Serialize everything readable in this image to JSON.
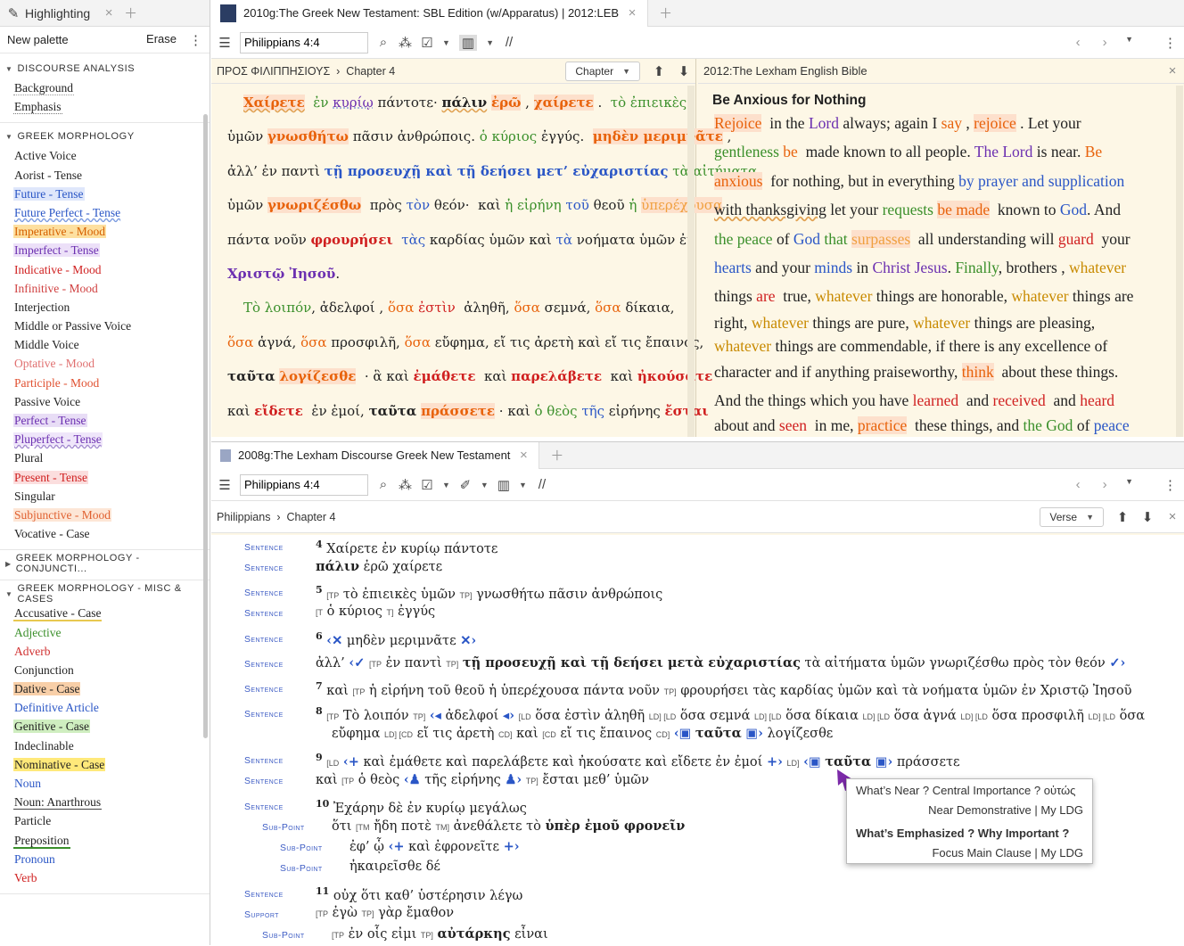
{
  "palette": {
    "tab": "Highlighting",
    "new_palette": "New palette",
    "erase": "Erase",
    "sections": [
      {
        "title": "DISCOURSE ANALYSIS",
        "items": [
          "Background",
          "Emphasis"
        ]
      },
      {
        "title": "GREEK MORPHOLOGY",
        "items": [
          "Active Voice",
          "Aorist - Tense",
          "Future - Tense",
          "Future Perfect - Tense",
          "Imperative - Mood",
          "Imperfect - Tense",
          "Indicative - Mood",
          "Infinitive - Mood",
          "Interjection",
          "Middle or Passive Voice",
          "Middle Voice",
          "Optative - Mood",
          "Participle - Mood",
          "Passive Voice",
          "Perfect - Tense",
          "Pluperfect - Tense",
          "Plural",
          "Present - Tense",
          "Singular",
          "Subjunctive - Mood",
          "Vocative - Case"
        ]
      },
      {
        "title": "GREEK MORPHOLOGY - CONJUNCTI...",
        "items": []
      },
      {
        "title": "GREEK MORPHOLOGY - MISC & CASES",
        "items": [
          "Accusative - Case",
          "Adjective",
          "Adverb",
          "Conjunction",
          "Dative - Case",
          "Definitive Article",
          "Genitive - Case",
          "Indeclinable",
          "Nominative - Case",
          "Noun",
          "Noun: Anarthrous",
          "Particle",
          "Preposition",
          "Pronoun",
          "Verb"
        ]
      }
    ]
  },
  "top": {
    "tab": "2010g:The Greek New Testament: SBL Edition (w/Apparatus) | 2012:LEB",
    "reference": "Philippians 4:4",
    "breadcrumb_book": "ΠΡΟΣ ΦΙΛΙΠΠΗΣΙΟΥΣ",
    "breadcrumb_chapter": "Chapter 4",
    "scope": "Chapter",
    "right_title": "2012:The Lexham English Bible",
    "heading": "Be Anxious for Nothing"
  },
  "bottom": {
    "tab": "2008g:The Lexham Discourse Greek New Testament",
    "reference": "Philippians 4:4",
    "breadcrumb_book": "Philippians",
    "breadcrumb_chapter": "Chapter 4",
    "scope": "Verse"
  },
  "labels": {
    "sentence": "Sentence",
    "sub_point": "Sub-Point",
    "support": "Support"
  },
  "popup": {
    "q1": "What’s Near ? Central Importance ? οὑτώς",
    "a1": "Near Demonstrative | My LDG",
    "q2": "What’s Emphasized ? Why Important ?",
    "a2": "Focus Main Clause | My LDG"
  }
}
